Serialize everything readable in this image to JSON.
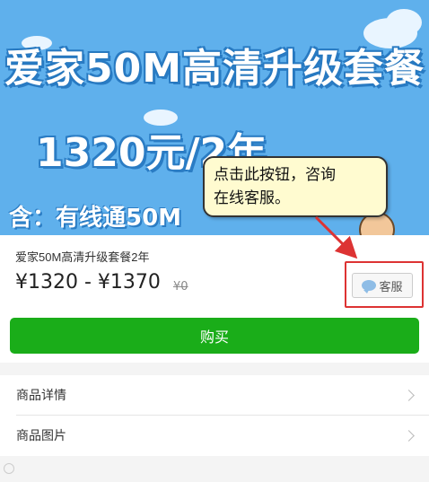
{
  "banner": {
    "title": "爱家50M高清升级套餐",
    "price": "1320元/2年",
    "contains": "含：有线通50M"
  },
  "callout": {
    "line1": "点击此按钮，咨询",
    "line2": "在线客服。"
  },
  "product": {
    "name": "爱家50M高清升级套餐2年",
    "price_range": "¥1320 - ¥1370",
    "original_price": "¥0",
    "service_label": "客服"
  },
  "buy": {
    "label": "购买"
  },
  "list": [
    {
      "label": "商品详情"
    },
    {
      "label": "商品图片"
    }
  ],
  "colors": {
    "banner_bg": "#5fb0ec",
    "buy_green": "#1aad19",
    "highlight_red": "#d33333",
    "callout_bg": "#fffbd0"
  },
  "icons": {
    "service": "chat-bubble-icon",
    "list_arrow": "chevron-right-icon",
    "watermark": "weibo-icon"
  }
}
